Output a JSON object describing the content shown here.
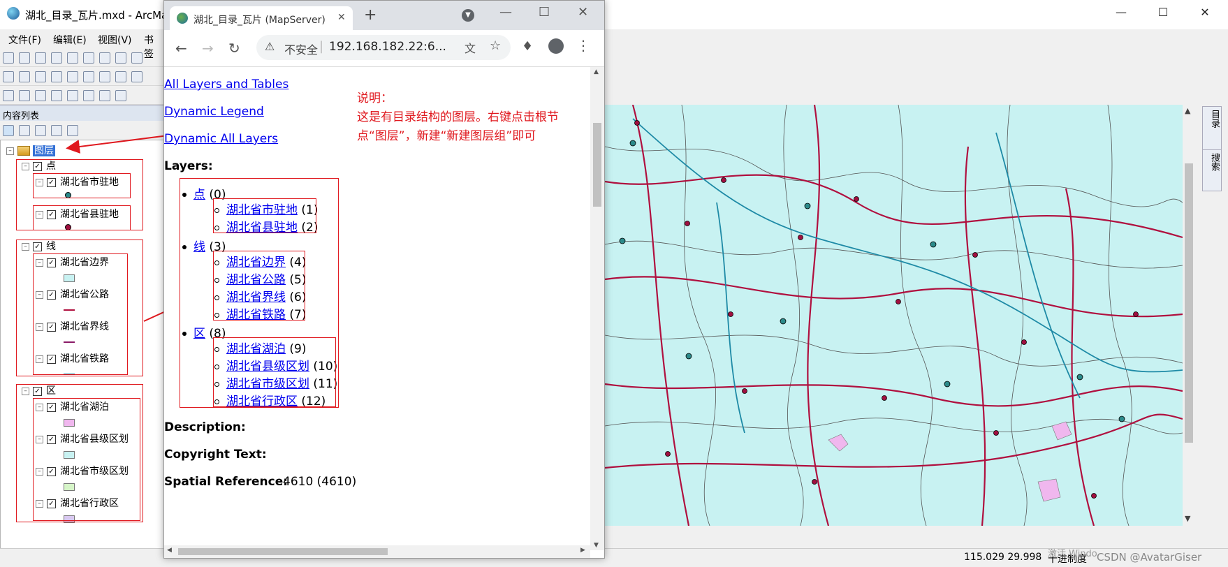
{
  "arcmap": {
    "title": "湖北_目录_瓦片.mxd - ArcMa",
    "menu": [
      "文件(F)",
      "编辑(E)",
      "视图(V)",
      "书签"
    ],
    "toc_title": "内容列表",
    "root_layer": "图层",
    "groups": [
      {
        "name": "点",
        "layers": [
          {
            "name": "湖北省市驻地",
            "sym": "dot",
            "color": "#2c8a8a"
          },
          {
            "name": "湖北省县驻地",
            "sym": "dot",
            "color": "#a01040"
          }
        ]
      },
      {
        "name": "线",
        "layers": [
          {
            "name": "湖北省边界",
            "sym": "fill",
            "color": "#c8f2f2"
          },
          {
            "name": "湖北省公路",
            "sym": "line",
            "color": "#b0103f"
          },
          {
            "name": "湖北省界线",
            "sym": "line",
            "color": "#8a1a66"
          },
          {
            "name": "湖北省铁路",
            "sym": "line",
            "color": "#1e8aa6"
          }
        ]
      },
      {
        "name": "区",
        "layers": [
          {
            "name": "湖北省湖泊",
            "sym": "fill",
            "color": "#f0b7ee"
          },
          {
            "name": "湖北省县级区划",
            "sym": "fill",
            "color": "#c8f2f2"
          },
          {
            "name": "湖北省市级区划",
            "sym": "fill",
            "color": "#d6f5c8"
          },
          {
            "name": "湖北省行政区",
            "sym": "fill",
            "color": "#d9c8f0"
          }
        ]
      }
    ],
    "side_tabs": [
      "目录",
      "搜索"
    ],
    "status": {
      "coords": "115.029  29.998",
      "units": "十进制度",
      "watermark": "CSDN @AvatarGiser",
      "activate": "激活 Windo"
    }
  },
  "browser": {
    "tab_title": "湖北_目录_瓦片 (MapServer)",
    "insecure": "不安全",
    "url": "192.168.182.22:6...",
    "links": [
      "All Layers and Tables",
      "Dynamic Legend",
      "Dynamic All Layers"
    ],
    "layers_label": "Layers:",
    "tree": [
      {
        "name": "点",
        "id": "(0)",
        "children": [
          {
            "name": "湖北省市驻地",
            "id": "(1)"
          },
          {
            "name": "湖北省县驻地",
            "id": "(2)"
          }
        ]
      },
      {
        "name": "线",
        "id": "(3)",
        "children": [
          {
            "name": "湖北省边界",
            "id": "(4)"
          },
          {
            "name": "湖北省公路",
            "id": "(5)"
          },
          {
            "name": "湖北省界线",
            "id": "(6)"
          },
          {
            "name": "湖北省铁路",
            "id": "(7)"
          }
        ]
      },
      {
        "name": "区",
        "id": "(8)",
        "children": [
          {
            "name": "湖北省湖泊",
            "id": "(9)"
          },
          {
            "name": "湖北省县级区划",
            "id": "(10)"
          },
          {
            "name": "湖北省市级区划",
            "id": "(11)"
          },
          {
            "name": "湖北省行政区",
            "id": "(12)"
          }
        ]
      }
    ],
    "description_label": "Description:",
    "copyright_label": "Copyright Text:",
    "spatial_label": "Spatial Reference:",
    "spatial_value": "4610  (4610)"
  },
  "annotation": {
    "title": "说明：",
    "text": "这是有目录结构的图层。右键点击根节点“图层”，新建“新建图层组”即可",
    "color": "#e0191f"
  }
}
